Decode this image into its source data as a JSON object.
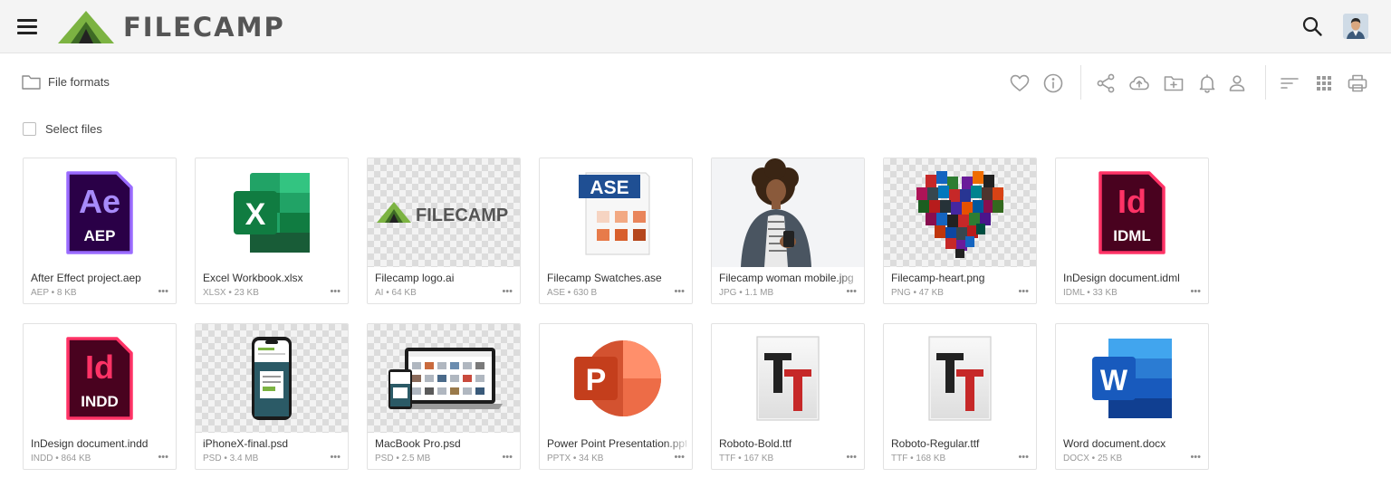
{
  "app": {
    "brand": "FILECAMP",
    "brand_color": "#6aa84f"
  },
  "header": {
    "menu_icon": "hamburger-menu-icon",
    "search_icon": "search-icon",
    "avatar": "user-avatar"
  },
  "breadcrumb": {
    "folder_icon": "folder-icon",
    "label": "File formats"
  },
  "toolbar": {
    "icons": [
      "heart-icon",
      "info-icon",
      "share-icon",
      "cloud-upload-icon",
      "new-folder-icon",
      "bell-icon",
      "user-icon",
      "sort-icon",
      "grid-view-icon",
      "print-icon"
    ]
  },
  "select_files": {
    "label": "Select files"
  },
  "files": [
    {
      "name": "After Effect project.aep",
      "meta": "AEP • 8 KB",
      "thumb": "aep",
      "badge": "AEP",
      "glyph": "Ae"
    },
    {
      "name": "Excel Workbook.xlsx",
      "meta": "XLSX • 23 KB",
      "thumb": "xlsx",
      "glyph": "X"
    },
    {
      "name": "Filecamp logo.ai",
      "meta": "AI • 64 KB",
      "thumb": "ai",
      "logo_text": "FILECAMP"
    },
    {
      "name": "Filecamp Swatches.ase",
      "meta": "ASE • 630 B",
      "thumb": "ase",
      "badge": "ASE"
    },
    {
      "name": "Filecamp woman mobile.jpg",
      "meta": "JPG • 1.1 MB",
      "thumb": "jpg"
    },
    {
      "name": "Filecamp-heart.png",
      "meta": "PNG • 47 KB",
      "thumb": "png"
    },
    {
      "name": "InDesign document.idml",
      "meta": "IDML • 33 KB",
      "thumb": "idml",
      "badge": "IDML",
      "glyph": "Id"
    },
    {
      "name": "InDesign document.indd",
      "meta": "INDD • 864 KB",
      "thumb": "indd",
      "badge": "INDD",
      "glyph": "Id"
    },
    {
      "name": "iPhoneX-final.psd",
      "meta": "PSD • 3.4 MB",
      "thumb": "iphone"
    },
    {
      "name": "MacBook Pro.psd",
      "meta": "PSD • 2.5 MB",
      "thumb": "macbook"
    },
    {
      "name": "Power Point Presentation.pptx",
      "meta": "PPTX • 34 KB",
      "thumb": "pptx",
      "glyph": "P"
    },
    {
      "name": "Roboto-Bold.ttf",
      "meta": "TTF • 167 KB",
      "thumb": "ttf"
    },
    {
      "name": "Roboto-Regular.ttf",
      "meta": "TTF • 168 KB",
      "thumb": "ttf"
    },
    {
      "name": "Word document.docx",
      "meta": "DOCX • 25 KB",
      "thumb": "docx",
      "glyph": "W"
    }
  ],
  "more_label": "•••"
}
